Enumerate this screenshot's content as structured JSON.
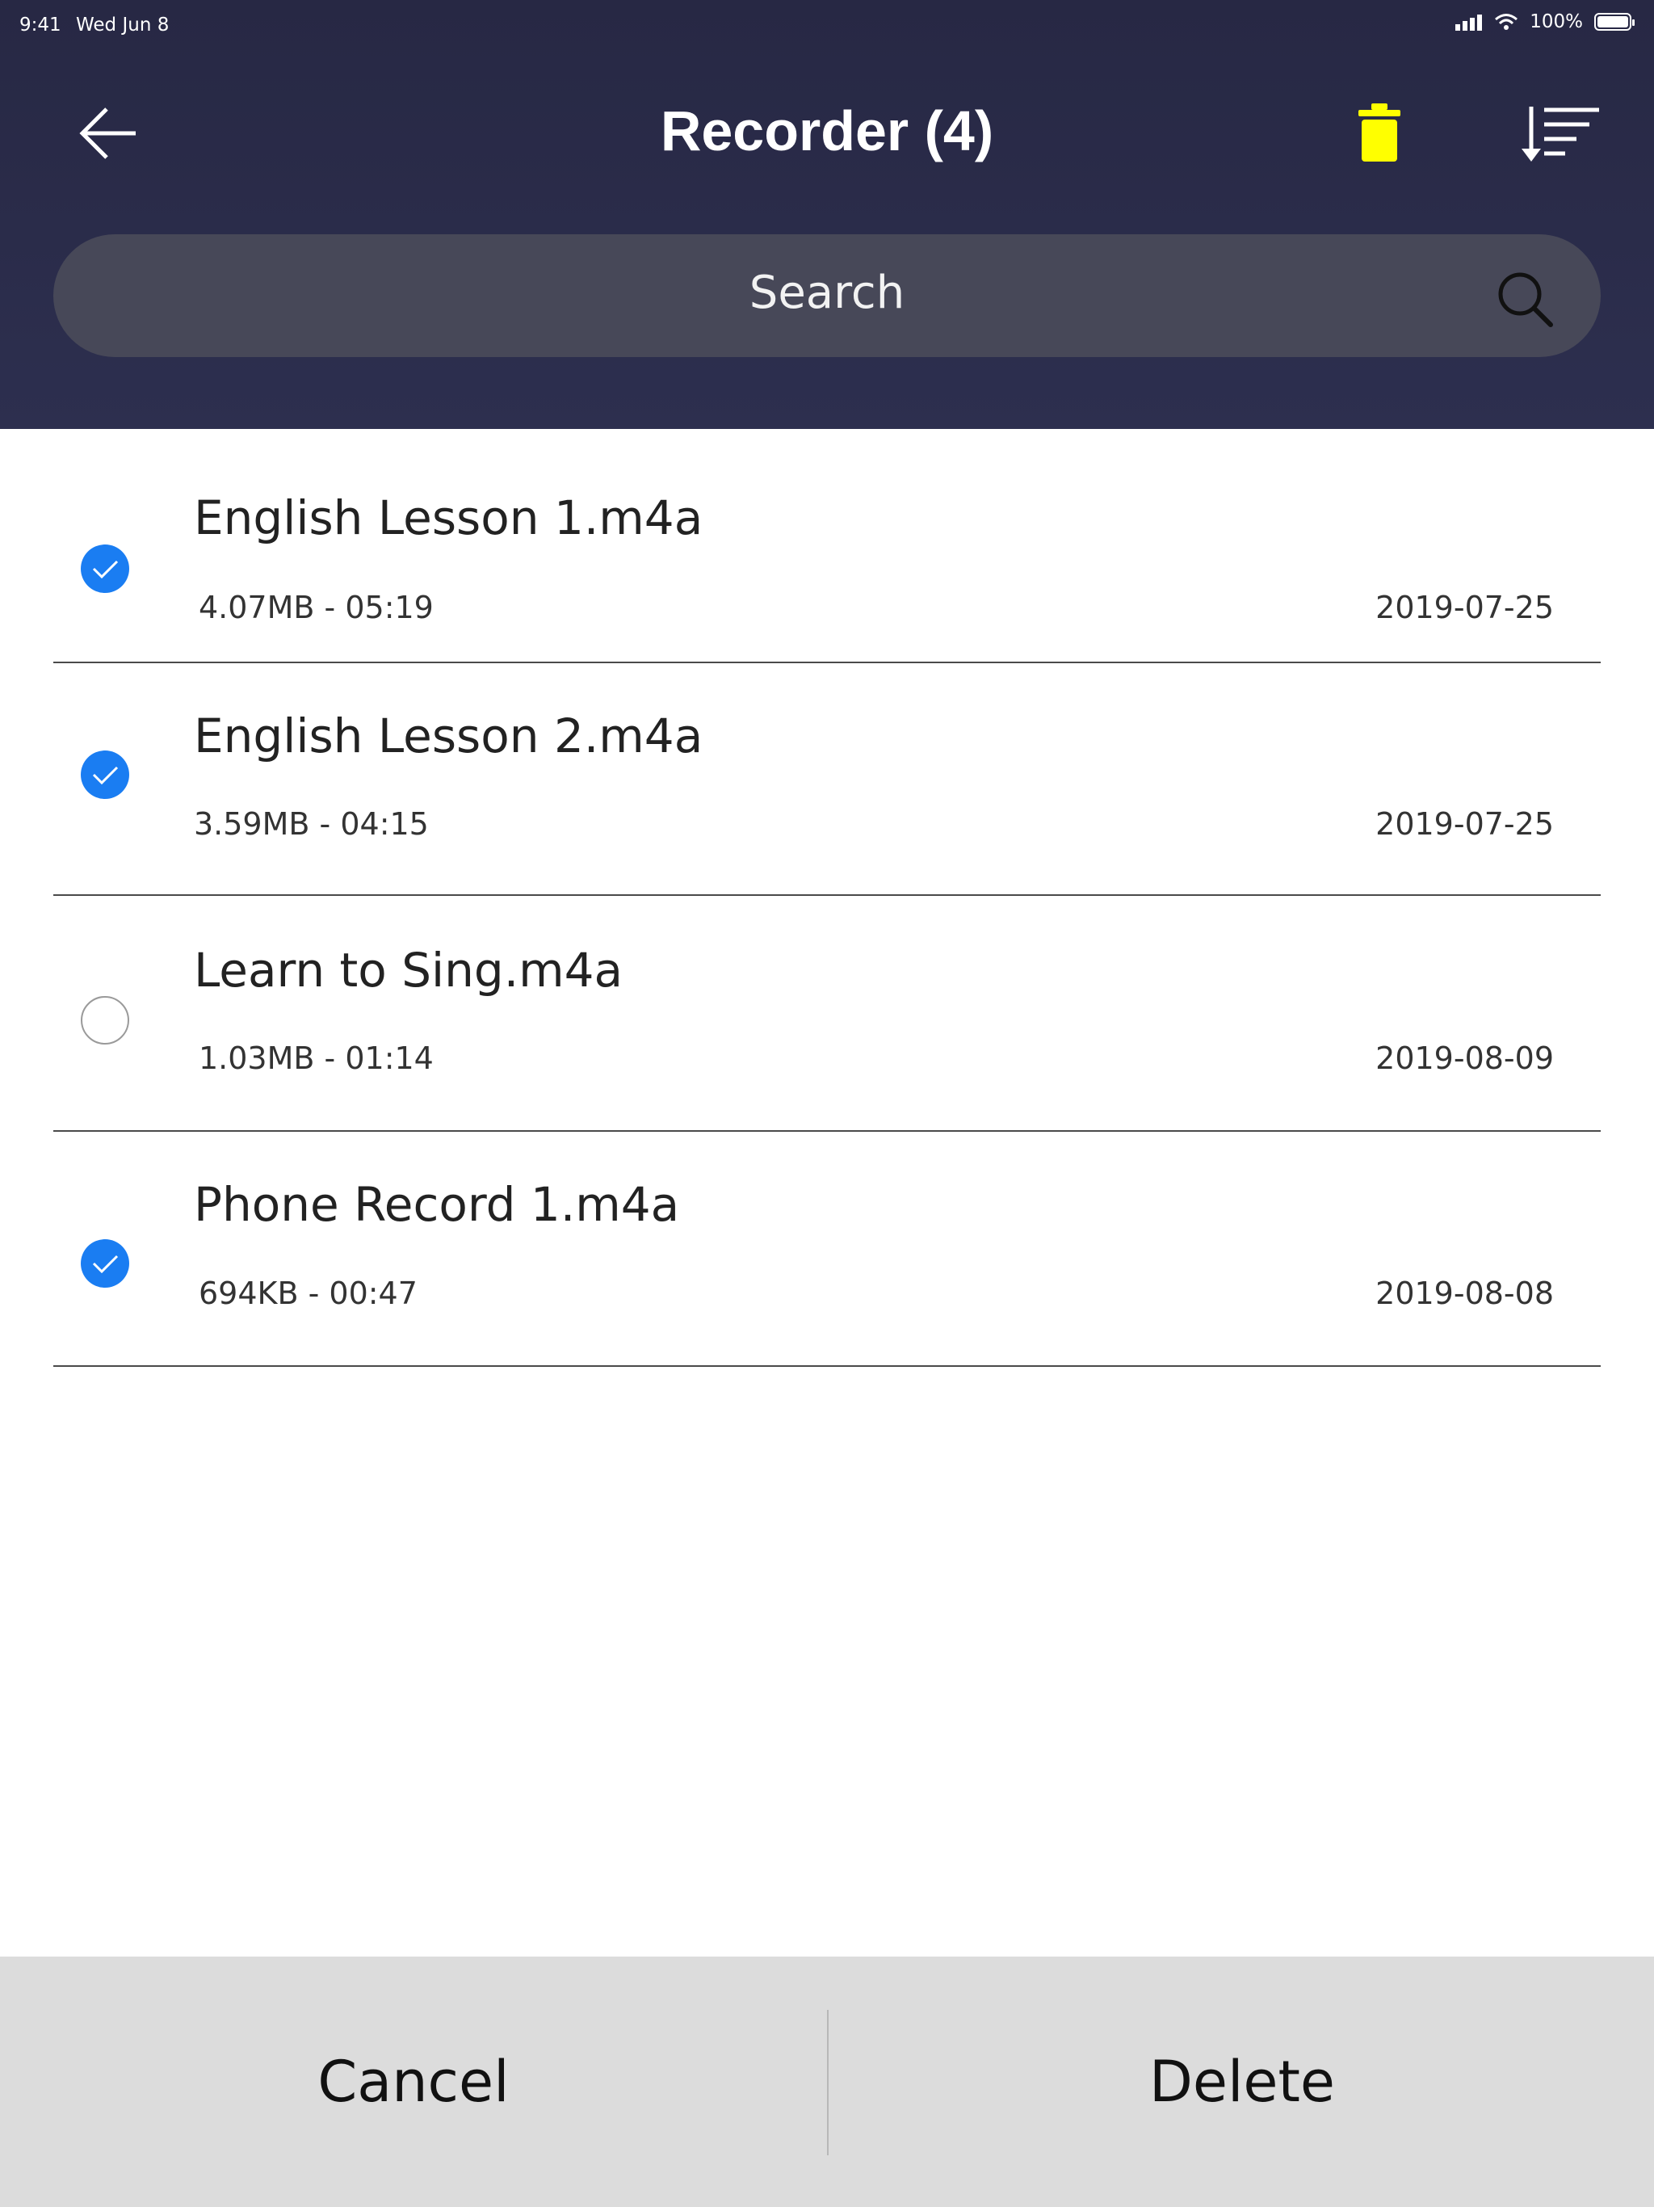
{
  "status_bar": {
    "time": "9:41",
    "date": "Wed Jun 8",
    "battery": "100%"
  },
  "header": {
    "title": "Recorder (4)",
    "icons": {
      "back": "arrow-left-icon",
      "delete": "trash-icon",
      "sort": "sort-icon"
    },
    "accent_color": "#ffff00"
  },
  "search": {
    "placeholder": "Search",
    "icon": "search-icon"
  },
  "recordings": [
    {
      "name": "English Lesson 1.m4a",
      "meta": "4.07MB - 05:19",
      "date": "2019-07-25",
      "selected": true
    },
    {
      "name": "English Lesson 2.m4a",
      "meta": "3.59MB - 04:15",
      "date": "2019-07-25",
      "selected": true
    },
    {
      "name": "Learn to Sing.m4a",
      "meta": "1.03MB - 01:14",
      "date": "2019-08-09",
      "selected": false
    },
    {
      "name": "Phone Record 1.m4a",
      "meta": "694KB - 00:47",
      "date": "2019-08-08",
      "selected": true
    }
  ],
  "actions": {
    "cancel": "Cancel",
    "delete": "Delete"
  },
  "colors": {
    "selected": "#1a7df2",
    "header": "#2a2b49"
  }
}
